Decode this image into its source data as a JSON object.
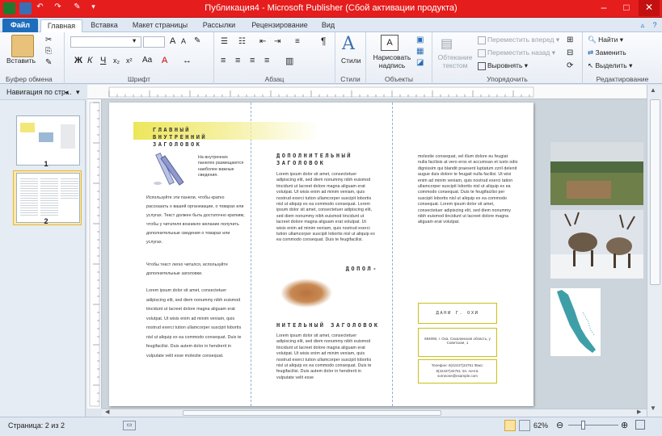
{
  "window": {
    "title": "Публикация4 - Microsoft Publisher (Сбой активации продукта)",
    "controls": [
      "minimize-icon",
      "maximize-icon",
      "close-icon"
    ],
    "accent": "#e51d1d"
  },
  "tabs": {
    "file": "Файл",
    "items": [
      "Главная",
      "Вставка",
      "Макет страницы",
      "Рассылки",
      "Рецензирование",
      "Вид"
    ],
    "active": "Главная"
  },
  "ribbon": {
    "clipboard": {
      "label": "Буфер обмена",
      "paste": "Вставить"
    },
    "font": {
      "label": "Шрифт",
      "family_value": "",
      "size_value": "",
      "bold": "Ж",
      "italic": "К",
      "underline": "Ч",
      "subscript": "x₂",
      "superscript": "x²",
      "grow": "A",
      "shrink": "A",
      "case": "Aa",
      "clear": "A"
    },
    "paragraph": {
      "label": "Абзац",
      "marks": "¶"
    },
    "styles": {
      "label": "Стили",
      "button": "Стили"
    },
    "objects": {
      "label": "Объекты",
      "draw_textbox": "Нарисовать надпись"
    },
    "arrange": {
      "label": "Упорядочить",
      "wrap_text": "Обтекание текстом",
      "bring_forward": "Переместить вперед",
      "send_backward": "Переместить назад",
      "align": "Выровнять"
    },
    "editing": {
      "label": "Редактирование",
      "find": "Найти",
      "replace": "Заменить",
      "select": "Выделить"
    }
  },
  "nav_pane": {
    "header": "Навигация по стр...",
    "pages": [
      {
        "number": "1",
        "selected": false
      },
      {
        "number": "2",
        "selected": true
      }
    ]
  },
  "document": {
    "col1": {
      "heading": "ГЛАВНЫЙ ВНУТРЕННИЙ ЗАГОЛОВОК",
      "caption": "На внутренних панелях размещаются наиболее важные сведения.",
      "para1": "Используйте эти панели, чтобы кратко рассказать о вашей организации, о товарах или услугах. Текст должен быть достаточно кратким, чтобы у читателя возникло желание получить дополнительные сведения о товарах или услугах.",
      "para2": "Чтобы текст легко читался, используйте дополнительные заголовки.",
      "para3": "Lorem ipsum dolor sit amet, consectetuer adipiscing elit, sed diem nonummy nibh euismod tincidunt ut lacreet dolore magna aliguam erat volutpat. Ut wisis enim ad minim veniam, quis nostrud exerci tution ullamcorper suscipit lobortis nisl ut aliquip ex ea commodo consequat. Duis te feugifacilisi. Duis autem dolor in hendrerit in vulputate velit esse molestie consequat."
    },
    "col2": {
      "heading1": "ДОПОЛНИТЕЛЬНЫЙ ЗАГОЛОВОК",
      "body1": "Lorem ipsum dolor sit amet, consectetuer adipiscing elit, sed diem nonummy nibh euismod tincidunt ut lacreet dolore magna aliguam erat volutpat. Ut wisis enim ad minim veniam, quis nostrud exerci tution ullamcorper suscipit lobortis nisl ut aliquip ex ea commodo consequat. Lorem ipsum dolor sit amet, consectetuer adipiscing elit, sed diem nonummy nibh euismod tincidunt ut lacreet dolore magna aliguam erat volutpat. Ut wisis enim ad minim veniam, quis nostrud exerci tution ullamcorper suscipit lobortis nisl ut aliquip ex ea commodo consequat. Duis te feugifacilisi.",
      "heading2a": "ДОПОЛ-",
      "heading2b": "НИТЕЛЬНЫЙ ЗАГОЛОВОК",
      "body2": "Lorem ipsum dolor sit amet, consectetuer adipiscing elit, sed diem nonummy nibh euismod tincidunt ut lacreet dolore magna aliguam erat volutpat. Ut wisis enim ad minim veniam, quis nostrud exerci tution ullamcorper suscipit lobortis nisl ut aliquip ex ea commodo consequat. Duis te feugifacilisi. Duis autem dolor in hendrerit in vulputate velit esse"
    },
    "col3": {
      "body": "molestie consequat, vel illum dolore eu feugiat nulla facilisis at vero eros et accumsan et iusto odio dignissim qui blandit praesent luptatum zzril delenit augue duis dolore te feugait nulla facilisi. Ut wisi enim ad minim veniam, quis nostrud exerci tation ullamcorper suscipit lobortis nisl ut aliquip ex ea commodo consequat. Duis te feugifacilisi per suscipit lobortis nisl ut aliquip ex ea commodo consequat. Lorem ipsum dolor sit amet, consectetuer adipiscing elit, sed diem nonummy nibh euismod tincidunt ut lacreet dolore magna aliguam erat volutpat.",
      "org_name": "ДАНИ Г. ОХИ",
      "address": "694090, г. Оха, Сахалинская область, у Советская, 1",
      "contacts": "Телефон: 8(42437)34751 Факс: 8(42437)34751 Эл. почта: someone@example.com"
    }
  },
  "status": {
    "page": "Страница: 2 из 2",
    "zoom": "62%",
    "zoom_level": 0.62
  }
}
